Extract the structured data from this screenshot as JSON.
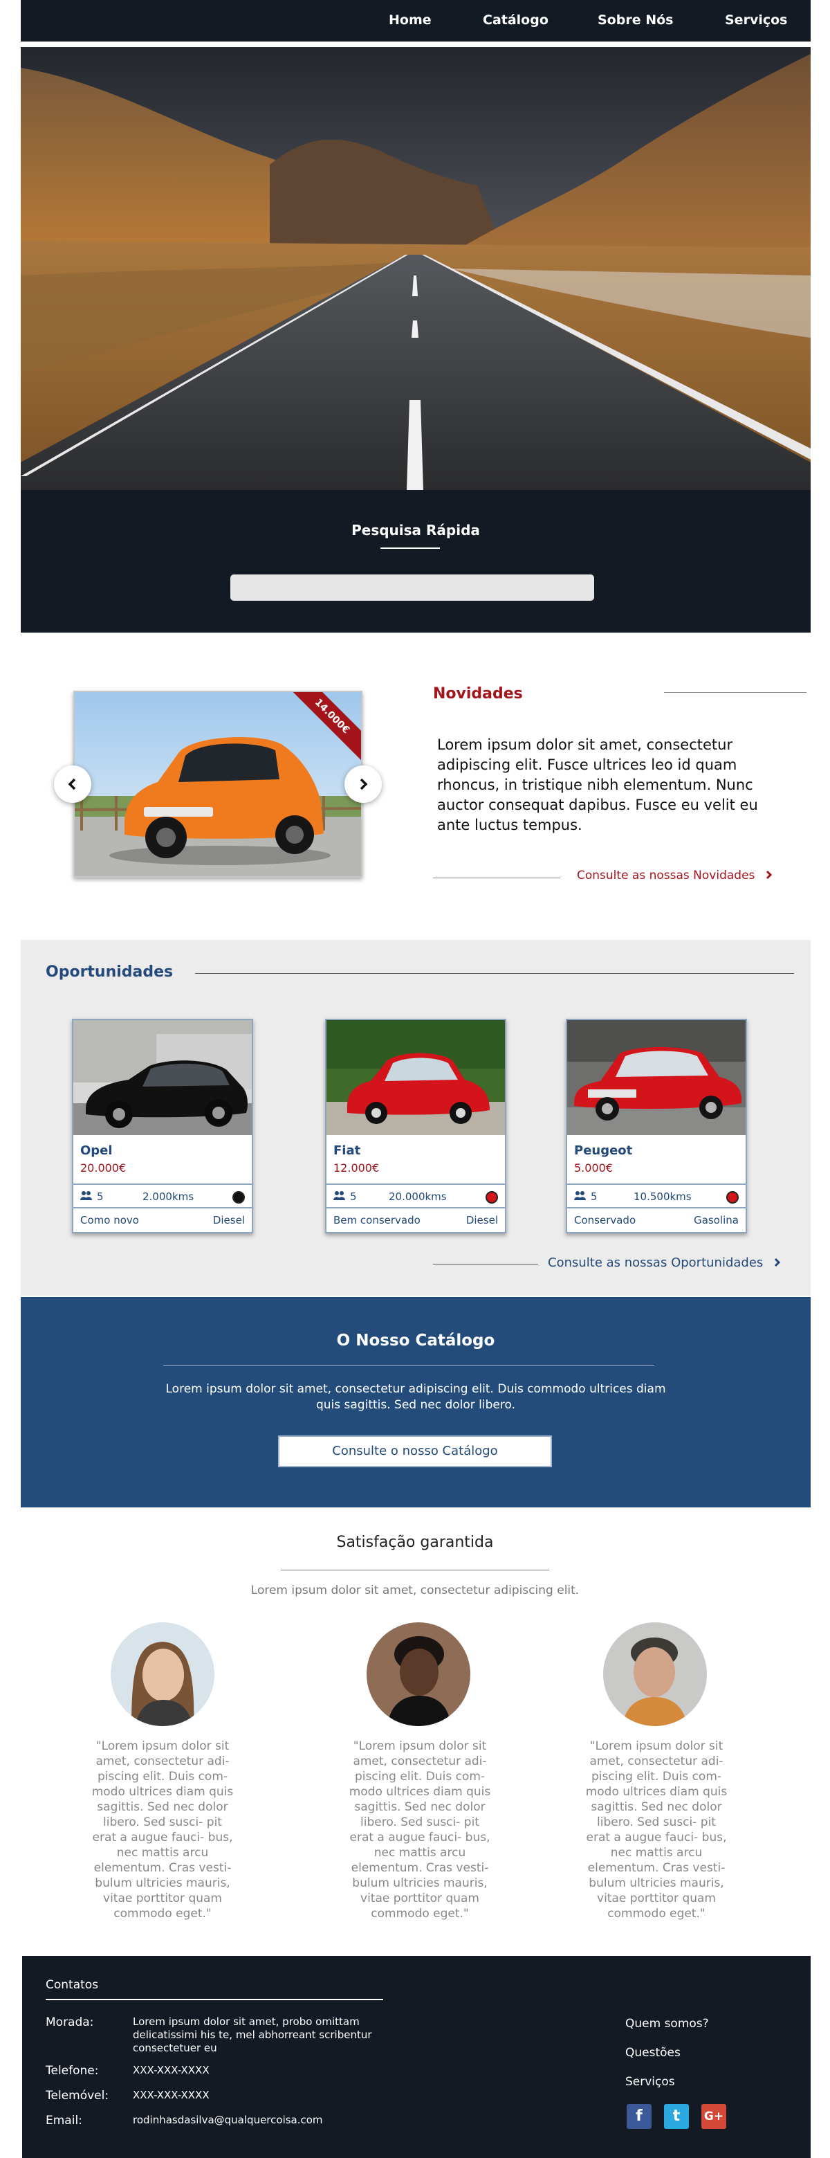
{
  "nav": {
    "items": [
      "Home",
      "Catálogo",
      "Sobre Nós",
      "Serviços"
    ]
  },
  "search": {
    "title": "Pesquisa Rápida",
    "placeholder": ""
  },
  "novidades": {
    "title": "Novidades",
    "price_ribbon": "14.000€",
    "text": "Lorem ipsum dolor sit amet, consectetur adipiscing elit. Fusce ultrices leo id quam rhoncus, in tristique nibh elementum. Nunc auctor consequat dapibus. Fusce eu velit eu ante luctus tempus.",
    "link": "Consulte as nossas Novidades",
    "car_color": "#f07a1e"
  },
  "oportunidades": {
    "title": "Oportunidades",
    "link": "Consulte as nossas Oportunidades",
    "cars": [
      {
        "name": "Opel",
        "price": "20.000€",
        "seats": "5",
        "km": "2.000kms",
        "condition": "Como novo",
        "fuel": "Diesel",
        "color": "#111111"
      },
      {
        "name": "Fiat",
        "price": "12.000€",
        "seats": "5",
        "km": "20.000kms",
        "condition": "Bem conservado",
        "fuel": "Diesel",
        "color": "#d3141b"
      },
      {
        "name": "Peugeot",
        "price": "5.000€",
        "seats": "5",
        "km": "10.500kms",
        "condition": "Conservado",
        "fuel": "Gasolina",
        "color": "#d3141b"
      }
    ]
  },
  "catalogo": {
    "title": "O Nosso Catálogo",
    "text": "Lorem ipsum dolor sit amet, consectetur adipiscing elit. Duis commodo ultrices diam quis sagittis. Sed nec dolor libero.",
    "button": "Consulte o nosso Catálogo"
  },
  "satisfacao": {
    "title": "Satisfação garantida",
    "subtitle": "Lorem ipsum dolor sit amet, consectetur adipiscing elit.",
    "quotes": [
      "\"Lorem ipsum dolor sit amet, consectetur adi- piscing elit. Duis com- modo ultrices diam quis sagittis. Sed nec dolor libero. Sed susci- pit erat a augue fauci- bus, nec mattis arcu elementum. Cras vesti- bulum ultricies mauris, vitae porttitor quam commodo eget.\"",
      "\"Lorem ipsum dolor sit amet, consectetur adi- piscing elit. Duis com- modo ultrices diam quis sagittis. Sed nec dolor libero. Sed susci- pit erat a augue fauci- bus, nec mattis arcu elementum. Cras vesti- bulum ultricies mauris, vitae porttitor quam commodo eget.\"",
      "\"Lorem ipsum dolor sit amet, consectetur adi- piscing elit. Duis com- modo ultrices diam quis sagittis. Sed nec dolor libero. Sed susci- pit erat a augue fauci- bus, nec mattis arcu elementum. Cras vesti- bulum ultricies mauris, vitae porttitor quam commodo eget.\""
    ]
  },
  "footer": {
    "title": "Contatos",
    "morada_label": "Morada:",
    "morada": "Lorem ipsum dolor sit amet, probo omittam delicatissimi his te, mel abhorreant scribentur consectetuer eu",
    "telefone_label": "Telefone:",
    "telefone": "XXX-XXX-XXXX",
    "telemovel_label": "Telemóvel:",
    "telemovel": "XXX-XXX-XXXX",
    "email_label": "Email:",
    "email": "rodinhasdasilva@qualquercoisa.com",
    "links": [
      "Quem somos?",
      "Questões",
      "Serviços"
    ],
    "social": [
      {
        "icon": "facebook-icon",
        "glyph": "f",
        "color": "#3b5998"
      },
      {
        "icon": "twitter-icon",
        "glyph": "t",
        "color": "#29a9e0"
      },
      {
        "icon": "google-plus-icon",
        "glyph": "G+",
        "color": "#d34836"
      }
    ]
  }
}
